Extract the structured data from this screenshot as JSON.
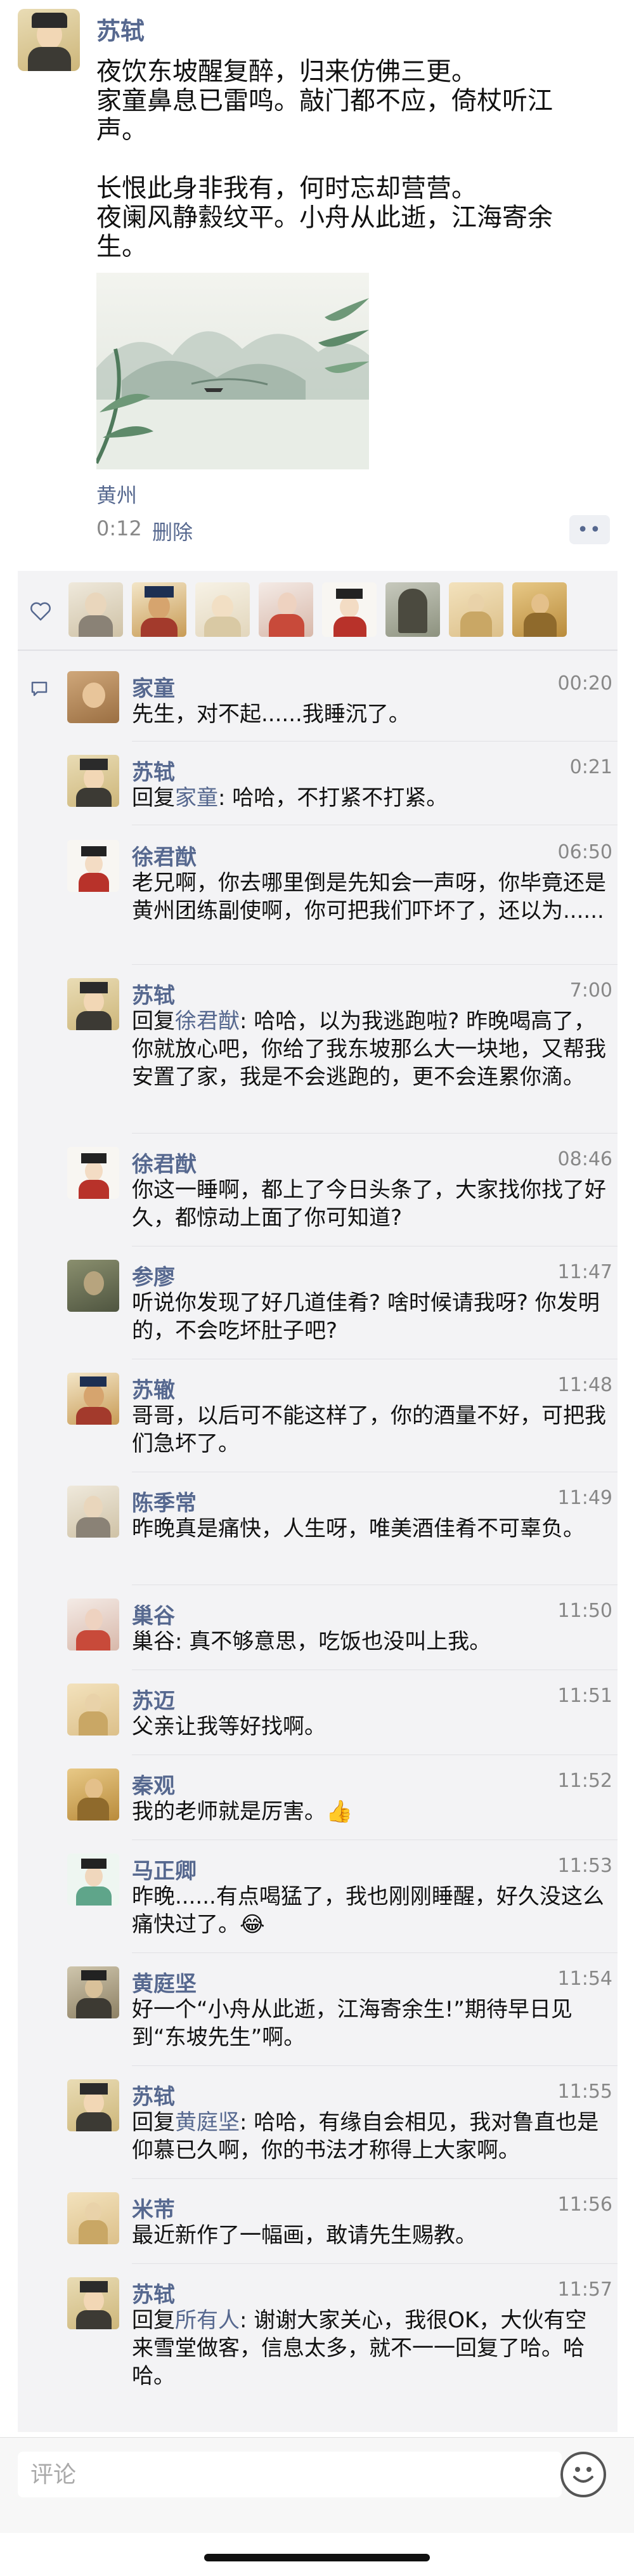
{
  "post": {
    "author": "苏轼",
    "text": "夜饮东坡醒复醉，归来仿佛三更。\n家童鼻息已雷鸣。敲门都不应，倚杖听江声。\n\n长恨此身非我有，何时忘却营营。\n夜阑风静縠纹平。小舟从此逝，江海寄余生。",
    "location": "黄州",
    "time": "0:12",
    "delete_label": "删除",
    "more_label": "••"
  },
  "likes": {
    "icon": "heart-outline-icon",
    "avatars": [
      "liker-1",
      "liker-2",
      "liker-3",
      "liker-4",
      "liker-5",
      "liker-6",
      "liker-7",
      "liker-8"
    ]
  },
  "comments": [
    {
      "name": "家童",
      "time": "00:20",
      "prefix": "",
      "reply_to": "",
      "text": "先生，对不起......我睡沉了。"
    },
    {
      "name": "苏轼",
      "time": "0:21",
      "prefix": "回复",
      "reply_to": "家童",
      "text": ": 哈哈，不打紧不打紧。"
    },
    {
      "name": "徐君猷",
      "time": "06:50",
      "prefix": "",
      "reply_to": "",
      "text": "老兄啊，你去哪里倒是先知会一声呀，你毕竟还是黄州团练副使啊，你可把我们吓坏了，还以为......"
    },
    {
      "name": "苏轼",
      "time": "7:00",
      "prefix": "回复",
      "reply_to": "徐君猷",
      "text": ": 哈哈，以为我逃跑啦? 昨晚喝高了，你就放心吧，你给了我东坡那么大一块地，又帮我安置了家，我是不会逃跑的，更不会连累你滴。"
    },
    {
      "name": "徐君猷",
      "time": "08:46",
      "prefix": "",
      "reply_to": "",
      "text": "你这一睡啊，都上了今日头条了，大家找你找了好久，都惊动上面了你可知道?"
    },
    {
      "name": "参廖",
      "time": "11:47",
      "prefix": "",
      "reply_to": "",
      "text": "听说你发现了好几道佳肴? 啥时候请我呀? 你发明的，不会吃坏肚子吧?"
    },
    {
      "name": "苏辙",
      "time": "11:48",
      "prefix": "",
      "reply_to": "",
      "text": "哥哥，以后可不能这样了，你的酒量不好，可把我们急坏了。"
    },
    {
      "name": "陈季常",
      "time": "11:49",
      "prefix": "",
      "reply_to": "",
      "text": "昨晚真是痛快，人生呀，唯美酒佳肴不可辜负。"
    },
    {
      "name": "巢谷",
      "time": "11:50",
      "prefix": "",
      "reply_to": "",
      "text": "巢谷: 真不够意思，吃饭也没叫上我。"
    },
    {
      "name": "苏迈",
      "time": "11:51",
      "prefix": "",
      "reply_to": "",
      "text": "父亲让我等好找啊。"
    },
    {
      "name": "秦观",
      "time": "11:52",
      "prefix": "",
      "reply_to": "",
      "text": "我的老师就是厉害。👍"
    },
    {
      "name": "马正卿",
      "time": "11:53",
      "prefix": "",
      "reply_to": "",
      "text": "昨晚......有点喝猛了，我也刚刚睡醒，好久没这么痛快过了。😂"
    },
    {
      "name": "黄庭坚",
      "time": "11:54",
      "prefix": "",
      "reply_to": "",
      "text": "好一个“小舟从此逝，江海寄余生!”期待早日见到“东坡先生”啊。"
    },
    {
      "name": "苏轼",
      "time": "11:55",
      "prefix": "回复",
      "reply_to": "黄庭坚",
      "text": ": 哈哈，有缘自会相见，我对鲁直也是仰慕已久啊，你的书法才称得上大家啊。"
    },
    {
      "name": "米芾",
      "time": "11:56",
      "prefix": "",
      "reply_to": "",
      "text": "最近新作了一幅画，敢请先生赐教。"
    },
    {
      "name": "苏轼",
      "time": "11:57",
      "prefix": "回复",
      "reply_to": "所有人",
      "text": ": 谢谢大家关心，我很OK，大伙有空来雪堂做客，信息太多，就不一一回复了哈。哈哈。"
    }
  ],
  "input": {
    "placeholder": "评论",
    "emoji_icon": "emoji-smile-icon"
  },
  "colors": {
    "link": "#56688f",
    "panel": "#f3f3f5",
    "divider": "#e1e1e5"
  }
}
